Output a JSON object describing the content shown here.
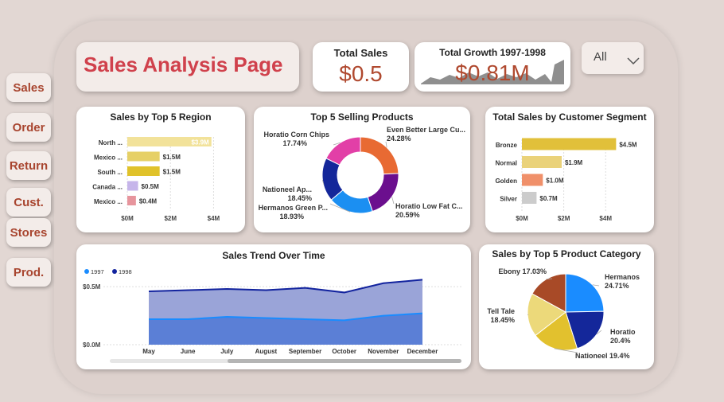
{
  "nav": {
    "items": [
      {
        "label": "Sales"
      },
      {
        "label": "Order"
      },
      {
        "label": "Return"
      },
      {
        "label": "Cust."
      },
      {
        "label": "Stores"
      },
      {
        "label": "Prod."
      }
    ]
  },
  "header": {
    "title": "Sales Analysis Page"
  },
  "kpis": {
    "total_sales": {
      "label": "Total Sales",
      "value": "$0.5"
    },
    "total_growth": {
      "label": "Total Growth 1997-1998",
      "value": "$0.81M"
    }
  },
  "slicer": {
    "value": "All",
    "icon": "chevron-down-icon"
  },
  "colors": {
    "accent": "#d0414c",
    "kpi": "#b0492f",
    "background": "#e2d7d3"
  },
  "chart_data": [
    {
      "id": "region",
      "type": "bar",
      "title": "Sales by Top 5 Region",
      "categories": [
        "North ...",
        "Mexico ...",
        "South ...",
        "Canada ...",
        "Mexico ..."
      ],
      "values": [
        3.9,
        1.5,
        1.5,
        0.5,
        0.4
      ],
      "data_labels": [
        "$3.9M",
        "$1.5M",
        "$1.5M",
        "$0.5M",
        "$0.4M"
      ],
      "bar_colors": [
        "#f2e29a",
        "#e6d066",
        "#e0c22a",
        "#c6b5ea",
        "#e7959d"
      ],
      "xticks": [
        "$0M",
        "$2M",
        "$4M"
      ],
      "xlim": [
        0,
        4.5
      ]
    },
    {
      "id": "products",
      "type": "pie",
      "donut": true,
      "title": "Top 5 Selling Products",
      "slices": [
        {
          "label": "Even Better Large Cu...",
          "pct": "24.28%",
          "value": 24.28,
          "color": "#e86a33"
        },
        {
          "label": "Horatio Low Fat C...",
          "pct": "20.59%",
          "value": 20.59,
          "color": "#6b0f8e"
        },
        {
          "label": "Hermanos Green P...",
          "pct": "18.93%",
          "value": 18.93,
          "color": "#1b8ff2"
        },
        {
          "label": "Nationeel Ap...",
          "pct": "18.45%",
          "value": 18.45,
          "color": "#14279a"
        },
        {
          "label": "Horatio Corn Chips",
          "pct": "17.74%",
          "value": 17.74,
          "color": "#e23fa7"
        }
      ]
    },
    {
      "id": "segment",
      "type": "bar",
      "title": "Total Sales by Customer Segment",
      "categories": [
        "Bronze",
        "Normal",
        "Golden",
        "Silver"
      ],
      "values": [
        4.5,
        1.9,
        1.0,
        0.7
      ],
      "data_labels": [
        "$4.5M",
        "$1.9M",
        "$1.0M",
        "$0.7M"
      ],
      "bar_colors": [
        "#e1c03a",
        "#ead27a",
        "#f0906a",
        "#cccccc"
      ],
      "xticks": [
        "$0M",
        "$2M",
        "$4M"
      ],
      "xlim": [
        0,
        4.6
      ]
    },
    {
      "id": "trend",
      "type": "area",
      "title": "Sales Trend Over Time",
      "categories": [
        "May",
        "June",
        "July",
        "August",
        "September",
        "October",
        "November",
        "December"
      ],
      "series": [
        {
          "name": "1997",
          "values": [
            0.22,
            0.22,
            0.24,
            0.23,
            0.22,
            0.21,
            0.25,
            0.27
          ],
          "color": "#1a8cff",
          "fill": "#5b7fd6"
        },
        {
          "name": "1998",
          "values": [
            0.46,
            0.47,
            0.48,
            0.47,
            0.49,
            0.45,
            0.53,
            0.56
          ],
          "color": "#12239e",
          "fill": "#9aa4d8"
        }
      ],
      "yticks": [
        "$0.0M",
        "$0.5M"
      ],
      "ylim": [
        0,
        0.7
      ],
      "legend": "top-left"
    },
    {
      "id": "category",
      "type": "pie",
      "title": "Sales by Top 5 Product Category",
      "slices": [
        {
          "label": "Hermanos",
          "pct": "24.71%",
          "value": 24.71,
          "color": "#1a8cff"
        },
        {
          "label": "Horatio",
          "pct": "20.4%",
          "value": 20.4,
          "color": "#14279a"
        },
        {
          "label": "Nationeel",
          "pct": "19.4%",
          "value": 19.4,
          "color": "#e2c12e"
        },
        {
          "label": "Tell Tale",
          "pct": "18.45%",
          "value": 18.45,
          "color": "#ecd97a"
        },
        {
          "label": "Ebony",
          "pct": "17.03%",
          "value": 17.03,
          "color": "#a84a27"
        }
      ]
    }
  ]
}
